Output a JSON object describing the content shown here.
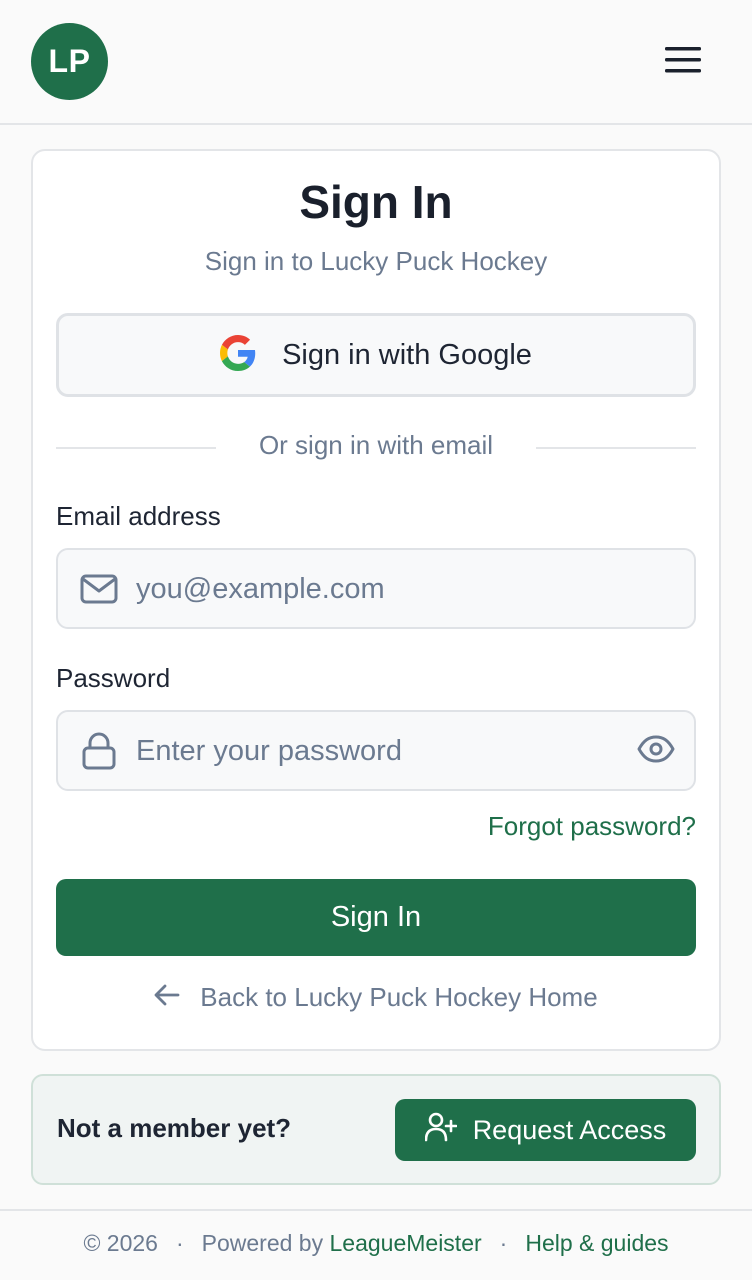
{
  "header": {
    "logo_initials": "LP"
  },
  "signin": {
    "title": "Sign In",
    "subtitle": "Sign in to Lucky Puck Hockey",
    "google_label": "Sign in with Google",
    "divider_text": "Or sign in with email",
    "email_label": "Email address",
    "email_placeholder": "you@example.com",
    "password_label": "Password",
    "password_placeholder": "Enter your password",
    "forgot_label": "Forgot password?",
    "submit_label": "Sign In",
    "back_label": "Back to Lucky Puck Hockey Home"
  },
  "member": {
    "prompt": "Not a member yet?",
    "request_label": "Request Access"
  },
  "footer": {
    "copyright": "© 2026",
    "powered_by": "Powered by",
    "powered_link": "LeagueMeister",
    "help_link": "Help & guides"
  },
  "colors": {
    "brand": "#1f6f4a",
    "muted_text": "#6b7a90",
    "border": "#e3e5e8"
  },
  "icons": [
    "menu-icon",
    "google-icon",
    "mail-icon",
    "lock-icon",
    "eye-icon",
    "arrow-left-icon",
    "user-plus-icon"
  ]
}
